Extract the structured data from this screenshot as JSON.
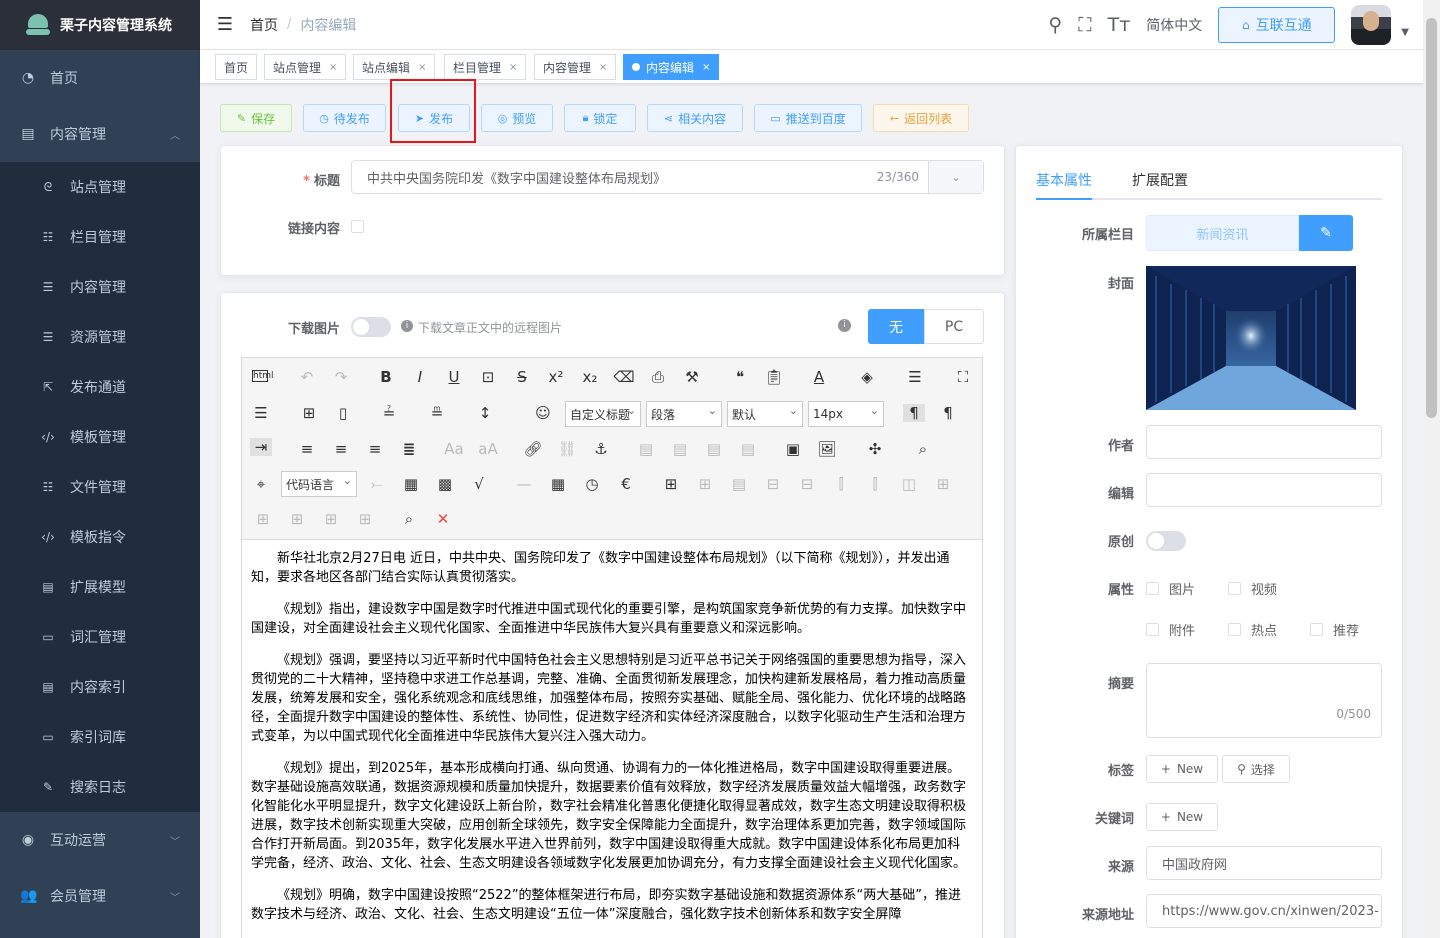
{
  "app": {
    "title": "栗子内容管理系统"
  },
  "sidebar": {
    "items": [
      {
        "label": "首页",
        "icon": "dashboard-icon"
      },
      {
        "label": "内容管理",
        "icon": "document-icon",
        "expanded": true,
        "children": [
          {
            "label": "站点管理",
            "icon": "site-icon"
          },
          {
            "label": "栏目管理",
            "icon": "tree-icon"
          },
          {
            "label": "内容管理",
            "icon": "list-icon"
          },
          {
            "label": "资源管理",
            "icon": "list-icon"
          },
          {
            "label": "发布通道",
            "icon": "publish-icon"
          },
          {
            "label": "模板管理",
            "icon": "code-icon"
          },
          {
            "label": "文件管理",
            "icon": "tree-icon"
          },
          {
            "label": "模板指令",
            "icon": "code-icon"
          },
          {
            "label": "扩展模型",
            "icon": "model-icon"
          },
          {
            "label": "词汇管理",
            "icon": "rect-icon"
          },
          {
            "label": "内容索引",
            "icon": "document-icon"
          },
          {
            "label": "索引词库",
            "icon": "rect-icon"
          },
          {
            "label": "搜索日志",
            "icon": "edit-icon"
          }
        ]
      },
      {
        "label": "互动运营",
        "icon": "interact-icon"
      },
      {
        "label": "会员管理",
        "icon": "user-icon"
      }
    ]
  },
  "header": {
    "breadcrumb": [
      "首页",
      "内容编辑"
    ],
    "lang": "简体中文",
    "hulian_button": "互联互通"
  },
  "tags": [
    {
      "label": "首页",
      "closable": false
    },
    {
      "label": "站点管理",
      "closable": true
    },
    {
      "label": "站点编辑",
      "closable": true
    },
    {
      "label": "栏目管理",
      "closable": true
    },
    {
      "label": "内容管理",
      "closable": true
    },
    {
      "label": "内容编辑",
      "closable": true,
      "active": true
    }
  ],
  "toolbar": {
    "save": "保存",
    "to_publish": "待发布",
    "publish": "发布",
    "preview": "预览",
    "lock": "锁定",
    "related": "相关内容",
    "push_baidu": "推送到百度",
    "back": "返回列表"
  },
  "form": {
    "title_label": "标题",
    "title_value": "中共中央国务院印发《数字中国建设整体布局规划》",
    "title_count": "23/360",
    "link_label": "链接内容",
    "download_label": "下载图片",
    "download_hint": "下载文章正文中的远程图片",
    "mode_none": "无",
    "mode_pc": "PC"
  },
  "editor": {
    "custom_title": "自定义标题",
    "paragraph": "段落",
    "font_default": "默认",
    "font_size": "14px",
    "code_lang": "代码语言",
    "paragraphs": [
      "新华社北京2月27日电 近日，中共中央、国务院印发了《数字中国建设整体布局规划》（以下简称《规划》），并发出通知，要求各地区各部门结合实际认真贯彻落实。",
      "《规划》指出，建设数字中国是数字时代推进中国式现代化的重要引擎，是构筑国家竞争新优势的有力支撑。加快数字中国建设，对全面建设社会主义现代化国家、全面推进中华民族伟大复兴具有重要意义和深远影响。",
      "《规划》强调，要坚持以习近平新时代中国特色社会主义思想特别是习近平总书记关于网络强国的重要思想为指导，深入贯彻党的二十大精神，坚持稳中求进工作总基调，完整、准确、全面贯彻新发展理念，加快构建新发展格局，着力推动高质量发展，统筹发展和安全，强化系统观念和底线思维，加强整体布局，按照夯实基础、赋能全局、强化能力、优化环境的战略路径，全面提升数字中国建设的整体性、系统性、协同性，促进数字经济和实体经济深度融合，以数字化驱动生产生活和治理方式变革，为以中国式现代化全面推进中华民族伟大复兴注入强大动力。",
      "《规划》提出，到2025年，基本形成横向打通、纵向贯通、协调有力的一体化推进格局，数字中国建设取得重要进展。数字基础设施高效联通，数据资源规模和质量加快提升，数据要素价值有效释放，数字经济发展质量效益大幅增强，政务数字化智能化水平明显提升，数字文化建设跃上新台阶，数字社会精准化普惠化便捷化取得显著成效，数字生态文明建设取得积极进展，数字技术创新实现重大突破，应用创新全球领先，数字安全保障能力全面提升，数字治理体系更加完善，数字领域国际合作打开新局面。到2035年，数字化发展水平进入世界前列，数字中国建设取得重大成就。数字中国建设体系化布局更加科学完备，经济、政治、文化、社会、生态文明建设各领域数字化发展更加协调充分，有力支撑全面建设社会主义现代化国家。",
      "《规划》明确，数字中国建设按照“2522”的整体框架进行布局，即夯实数字基础设施和数据资源体系“两大基础”，推进数字技术与经济、政治、文化、社会、生态文明建设“五位一体”深度融合，强化数字技术创新体系和数字安全屏障"
    ]
  },
  "right_panel": {
    "tab_basic": "基本属性",
    "tab_ext": "扩展配置",
    "column_label": "所属栏目",
    "column_value": "新闻资讯",
    "cover_label": "封面",
    "author_label": "作者",
    "editor_label": "编辑",
    "original_label": "原创",
    "attr_label": "属性",
    "attrs": [
      "图片",
      "视频",
      "附件",
      "热点",
      "推荐"
    ],
    "summary_label": "摘要",
    "summary_count": "0/500",
    "tag_label": "标签",
    "tag_new": "New",
    "tag_select": "选择",
    "keyword_label": "关键词",
    "keyword_new": "New",
    "source_label": "来源",
    "source_value": "中国政府网",
    "source_url_label": "来源地址",
    "source_url_value": "https://www.gov.cn/xinwen/2023-"
  }
}
